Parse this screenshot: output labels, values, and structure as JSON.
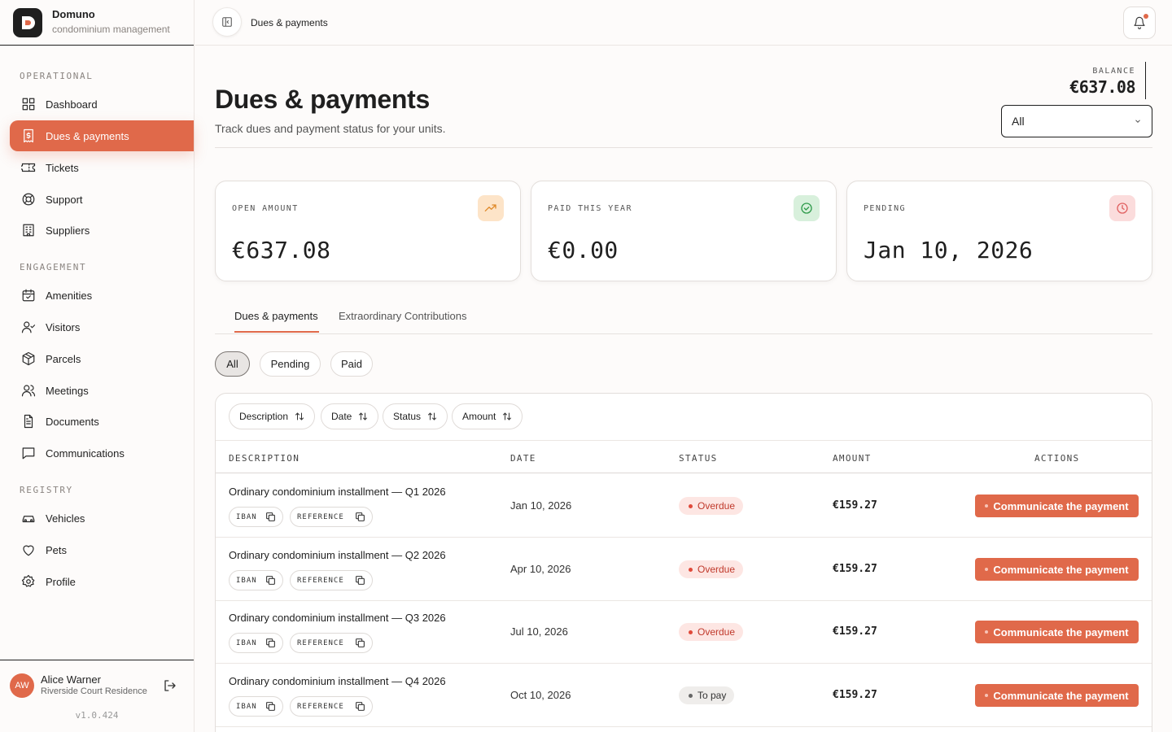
{
  "brand": {
    "name": "Domuno",
    "subtitle": "condominium management"
  },
  "sidebar": {
    "sections": {
      "operational": "OPERATIONAL",
      "engagement": "ENGAGEMENT",
      "registry": "REGISTRY"
    },
    "items": [
      {
        "label": "Dashboard",
        "icon": "grid-icon"
      },
      {
        "label": "Dues & payments",
        "icon": "receipt-dollar-icon",
        "active": true
      },
      {
        "label": "Tickets",
        "icon": "ticket-icon"
      },
      {
        "label": "Support",
        "icon": "life-buoy-icon"
      },
      {
        "label": "Suppliers",
        "icon": "building-icon"
      },
      {
        "label": "Amenities",
        "icon": "calendar-check-icon"
      },
      {
        "label": "Visitors",
        "icon": "user-check-icon"
      },
      {
        "label": "Parcels",
        "icon": "package-icon"
      },
      {
        "label": "Meetings",
        "icon": "users-icon"
      },
      {
        "label": "Documents",
        "icon": "file-text-icon"
      },
      {
        "label": "Communications",
        "icon": "message-square-icon"
      },
      {
        "label": "Vehicles",
        "icon": "car-icon"
      },
      {
        "label": "Pets",
        "icon": "heart-icon"
      },
      {
        "label": "Profile",
        "icon": "gear-icon"
      }
    ],
    "user": {
      "initials": "AW",
      "name": "Alice Warner",
      "residence": "Riverside Court Residence"
    },
    "version": "v1.0.424"
  },
  "topbar": {
    "breadcrumb": "Dues & payments"
  },
  "header": {
    "title": "Dues & payments",
    "subtitle": "Track dues and payment status for your units.",
    "balance_label": "BALANCE",
    "balance_value": "€637.08",
    "unit_select": "All"
  },
  "cards": [
    {
      "label": "OPEN AMOUNT",
      "value": "€637.08",
      "icon": "trending-up-icon",
      "accent": "#fde4c8"
    },
    {
      "label": "PAID THIS YEAR",
      "value": "€0.00",
      "icon": "check-circle-icon",
      "accent": "#d8f0dc"
    },
    {
      "label": "PENDING",
      "value": "Jan 10, 2026",
      "icon": "clock-icon",
      "accent": "#fbdcdc"
    }
  ],
  "tabs": [
    "Dues & payments",
    "Extraordinary Contributions"
  ],
  "filters": [
    "All",
    "Pending",
    "Paid"
  ],
  "sort_buttons": [
    "Description",
    "Date",
    "Status",
    "Amount"
  ],
  "table": {
    "columns": [
      "DESCRIPTION",
      "DATE",
      "STATUS",
      "AMOUNT",
      "ACTIONS"
    ],
    "chip_labels": {
      "iban": "IBAN",
      "reference": "REFERENCE"
    },
    "action_label": "Communicate the payment",
    "rows": [
      {
        "description": "Ordinary condominium installment — Q1 2026",
        "date": "Jan 10, 2026",
        "status": "Overdue",
        "amount": "€159.27"
      },
      {
        "description": "Ordinary condominium installment — Q2 2026",
        "date": "Apr 10, 2026",
        "status": "Overdue",
        "amount": "€159.27"
      },
      {
        "description": "Ordinary condominium installment — Q3 2026",
        "date": "Jul 10, 2026",
        "status": "Overdue",
        "amount": "€159.27"
      },
      {
        "description": "Ordinary condominium installment — Q4 2026",
        "date": "Oct 10, 2026",
        "status": "To pay",
        "amount": "€159.27"
      }
    ]
  },
  "colors": {
    "accent": "#e0694a",
    "overdue": "#c0392b"
  }
}
